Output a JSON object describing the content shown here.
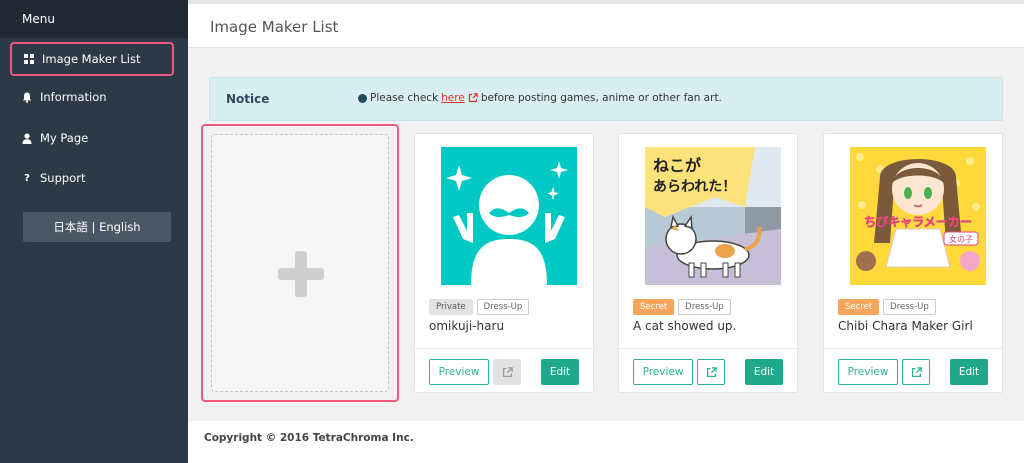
{
  "sidebar": {
    "header": "Menu",
    "items": [
      {
        "label": "Image Maker List",
        "icon": "grid-icon"
      },
      {
        "label": "Information",
        "icon": "bell-icon"
      },
      {
        "label": "My Page",
        "icon": "user-icon"
      },
      {
        "label": "Support",
        "icon": "question-icon"
      }
    ],
    "language_button": "日本語 | English"
  },
  "main": {
    "title": "Image Maker List",
    "notice": {
      "title": "Notice",
      "text_before": "Please check",
      "link": "here",
      "text_after": "before posting games, anime or other fan art."
    },
    "cards": [
      {
        "tags": [
          "Private",
          "Dress-Up"
        ],
        "name": "omikuji-haru",
        "preview": "Preview",
        "edit": "Edit"
      },
      {
        "tags": [
          "Secret",
          "Dress-Up"
        ],
        "name": "A cat showed up.",
        "preview": "Preview",
        "edit": "Edit",
        "image_text": "ねこが\nあらわれた！"
      },
      {
        "tags": [
          "Secret",
          "Dress-Up"
        ],
        "name": "Chibi Chara Maker Girl",
        "preview": "Preview",
        "edit": "Edit",
        "image_text": "ちびキャラメーカー",
        "image_subtext": "女の子"
      }
    ]
  },
  "footer": {
    "copyright": "Copyright © 2016 TetraChroma Inc."
  },
  "colors": {
    "sidebar_bg": "#2c3a47",
    "accent_teal": "#1fa98a",
    "highlight_pink": "#ef5a7f",
    "secret_orange": "#f6a55a",
    "notice_bg": "#d9eef3"
  }
}
